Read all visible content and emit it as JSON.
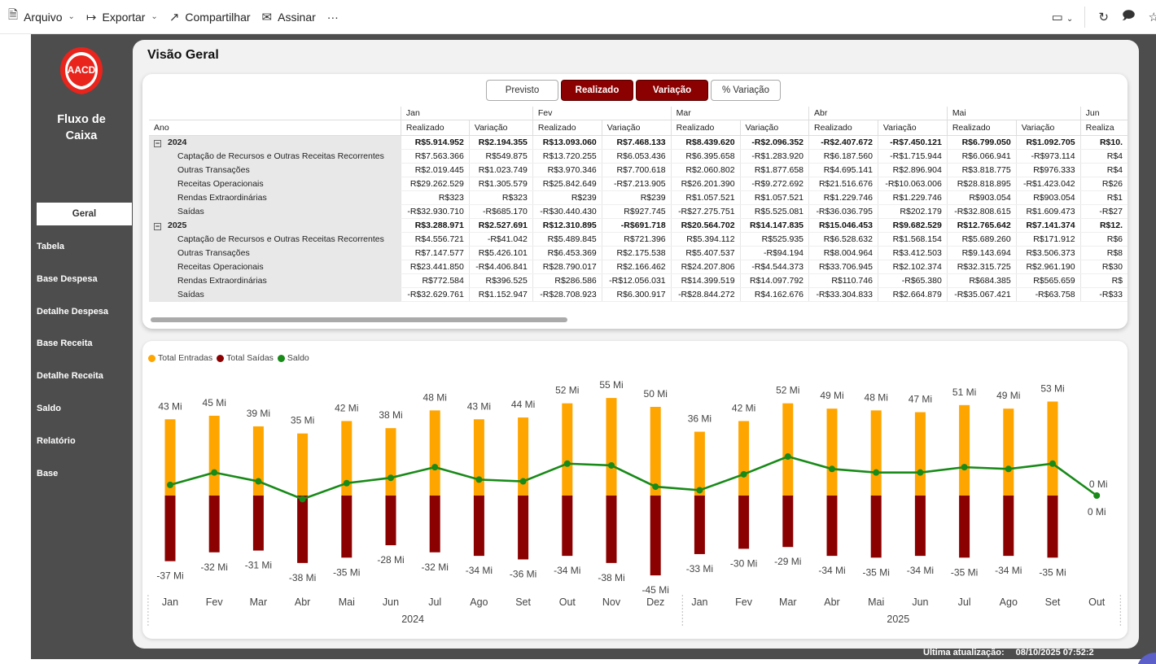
{
  "toolbar": {
    "file": "Arquivo",
    "export": "Exportar",
    "share": "Compartilhar",
    "sign": "Assinar",
    "more": "···"
  },
  "nav": {
    "logo_text": "AACD",
    "title_line1": "Fluxo de",
    "title_line2": "Caixa",
    "items": [
      "Geral",
      "Tabela",
      "Base Despesa",
      "Detalhe Despesa",
      "Base Receita",
      "Detalhe Receita",
      "Saldo",
      "Relatório",
      "Base"
    ]
  },
  "page": {
    "title": "Visão Geral"
  },
  "toggles": [
    "Previsto",
    "Realizado",
    "Variação",
    "% Variação"
  ],
  "table": {
    "row_header": "Ano",
    "months": [
      "Jan",
      "Fev",
      "Mar",
      "Abr",
      "Mai",
      "Jun"
    ],
    "measures": [
      "Realizado",
      "Variação"
    ],
    "sub_short": "Realiza",
    "groups": [
      {
        "year": "2024",
        "total": [
          "R$5.914.952",
          "R$2.194.355",
          "R$13.093.060",
          "R$7.468.133",
          "R$8.439.620",
          "-R$2.096.352",
          "-R$2.407.672",
          "-R$7.450.121",
          "R$6.799.050",
          "R$1.092.705",
          "R$10."
        ],
        "rows": [
          {
            "label": "Captação de Recursos e Outras Receitas Recorrentes",
            "cells": [
              "R$7.563.366",
              "R$549.875",
              "R$13.720.255",
              "R$6.053.436",
              "R$6.395.658",
              "-R$1.283.920",
              "R$6.187.560",
              "-R$1.715.944",
              "R$6.066.941",
              "-R$973.114",
              "R$4"
            ]
          },
          {
            "label": "Outras Transações",
            "cells": [
              "R$2.019.445",
              "R$1.023.749",
              "R$3.970.346",
              "R$7.700.618",
              "R$2.060.802",
              "R$1.877.658",
              "R$4.695.141",
              "R$2.896.904",
              "R$3.818.775",
              "R$976.333",
              "R$4"
            ]
          },
          {
            "label": "Receitas Operacionais",
            "cells": [
              "R$29.262.529",
              "R$1.305.579",
              "R$25.842.649",
              "-R$7.213.905",
              "R$26.201.390",
              "-R$9.272.692",
              "R$21.516.676",
              "-R$10.063.006",
              "R$28.818.895",
              "-R$1.423.042",
              "R$26"
            ]
          },
          {
            "label": "Rendas Extraordinárias",
            "cells": [
              "R$323",
              "R$323",
              "R$239",
              "R$239",
              "R$1.057.521",
              "R$1.057.521",
              "R$1.229.746",
              "R$1.229.746",
              "R$903.054",
              "R$903.054",
              "R$1"
            ]
          },
          {
            "label": "Saídas",
            "cells": [
              "-R$32.930.710",
              "-R$685.170",
              "-R$30.440.430",
              "R$927.745",
              "-R$27.275.751",
              "R$5.525.081",
              "-R$36.036.795",
              "R$202.179",
              "-R$32.808.615",
              "R$1.609.473",
              "-R$27"
            ]
          }
        ]
      },
      {
        "year": "2025",
        "total": [
          "R$3.288.971",
          "R$2.527.691",
          "R$12.310.895",
          "-R$691.718",
          "R$20.564.702",
          "R$14.147.835",
          "R$15.046.453",
          "R$9.682.529",
          "R$12.765.642",
          "R$7.141.374",
          "R$12."
        ],
        "rows": [
          {
            "label": "Captação de Recursos e Outras Receitas Recorrentes",
            "cells": [
              "R$4.556.721",
              "-R$41.042",
              "R$5.489.845",
              "R$721.396",
              "R$5.394.112",
              "R$525.935",
              "R$6.528.632",
              "R$1.568.154",
              "R$5.689.260",
              "R$171.912",
              "R$6"
            ]
          },
          {
            "label": "Outras Transações",
            "cells": [
              "R$7.147.577",
              "R$5.426.101",
              "R$6.453.369",
              "R$2.175.538",
              "R$5.407.537",
              "-R$94.194",
              "R$8.004.964",
              "R$3.412.503",
              "R$9.143.694",
              "R$3.506.373",
              "R$8"
            ]
          },
          {
            "label": "Receitas Operacionais",
            "cells": [
              "R$23.441.850",
              "-R$4.406.841",
              "R$28.790.017",
              "R$2.166.462",
              "R$24.207.806",
              "-R$4.544.373",
              "R$33.706.945",
              "R$2.102.374",
              "R$32.315.725",
              "R$2.961.190",
              "R$30"
            ]
          },
          {
            "label": "Rendas Extraordinárias",
            "cells": [
              "R$772.584",
              "R$396.525",
              "R$286.586",
              "-R$12.056.031",
              "R$14.399.519",
              "R$14.097.792",
              "R$110.746",
              "-R$65.380",
              "R$684.385",
              "R$565.659",
              "R$"
            ]
          },
          {
            "label": "Saídas",
            "cells": [
              "-R$32.629.761",
              "R$1.152.947",
              "-R$28.708.923",
              "R$6.300.917",
              "-R$28.844.272",
              "R$4.162.676",
              "-R$33.304.833",
              "R$2.664.879",
              "-R$35.067.421",
              "-R$63.758",
              "-R$33"
            ]
          }
        ]
      }
    ]
  },
  "chart_data": {
    "type": "bar",
    "legend": [
      "Total Entradas",
      "Total Saídas",
      "Saldo"
    ],
    "colors": {
      "entradas": "#ffa500",
      "saidas": "#8b0000",
      "saldo": "#188a18"
    },
    "categories": [
      "Jan",
      "Fev",
      "Mar",
      "Abr",
      "Mai",
      "Jun",
      "Jul",
      "Ago",
      "Set",
      "Out",
      "Nov",
      "Dez",
      "Jan",
      "Fev",
      "Mar",
      "Abr",
      "Mai",
      "Jun",
      "Jul",
      "Ago",
      "Set",
      "Out"
    ],
    "years": [
      {
        "label": "2024",
        "count": 12
      },
      {
        "label": "2025",
        "count": 10
      }
    ],
    "series": [
      {
        "name": "Total Entradas",
        "kind": "bar",
        "values": [
          43,
          45,
          39,
          35,
          42,
          38,
          48,
          43,
          44,
          52,
          55,
          50,
          36,
          42,
          52,
          49,
          48,
          47,
          51,
          49,
          53,
          0
        ]
      },
      {
        "name": "Total Saídas",
        "kind": "bar",
        "values": [
          -37,
          -32,
          -31,
          -38,
          -35,
          -28,
          -32,
          -34,
          -36,
          -34,
          -38,
          -45,
          -33,
          -30,
          -29,
          -34,
          -35,
          -34,
          -35,
          -34,
          -35,
          0
        ]
      },
      {
        "name": "Saldo",
        "kind": "line",
        "values": [
          6,
          13,
          8,
          -2,
          7,
          10,
          16,
          9,
          8,
          18,
          17,
          5,
          3,
          12,
          22,
          15,
          13,
          13,
          16,
          15,
          18,
          0
        ]
      }
    ],
    "entradas_labels": [
      "43 Mi",
      "45 Mi",
      "39 Mi",
      "35 Mi",
      "42 Mi",
      "38 Mi",
      "48 Mi",
      "43 Mi",
      "44 Mi",
      "52 Mi",
      "55 Mi",
      "50 Mi",
      "36 Mi",
      "42 Mi",
      "52 Mi",
      "49 Mi",
      "48 Mi",
      "47 Mi",
      "51 Mi",
      "49 Mi",
      "53 Mi",
      "0 Mi"
    ],
    "saidas_labels": [
      "-37 Mi",
      "-32 Mi",
      "-31 Mi",
      "-38 Mi",
      "-35 Mi",
      "-28 Mi",
      "-32 Mi",
      "-34 Mi",
      "-36 Mi",
      "-34 Mi",
      "-38 Mi",
      "-45 Mi",
      "-33 Mi",
      "-30 Mi",
      "-29 Mi",
      "-34 Mi",
      "-35 Mi",
      "-34 Mi",
      "-35 Mi",
      "-34 Mi",
      "-35 Mi",
      "0 Mi"
    ]
  },
  "footer": {
    "label": "Ultima atualização:",
    "value": "08/10/2025 07:52:2"
  }
}
